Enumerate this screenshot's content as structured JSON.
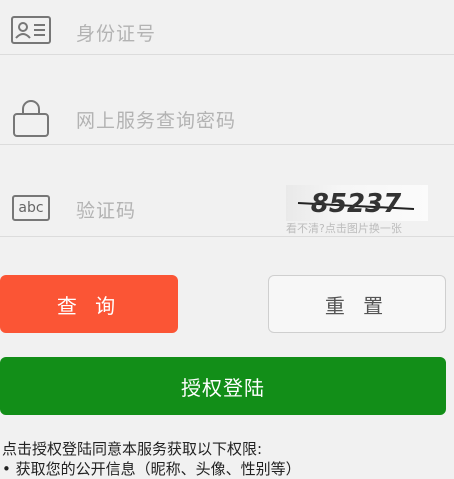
{
  "form": {
    "id_field": {
      "placeholder": "身份证号",
      "icon": "id-card-icon"
    },
    "password_field": {
      "placeholder": "网上服务查询密码",
      "icon": "lock-icon"
    },
    "captcha_field": {
      "placeholder": "验证码",
      "icon_text": "abc",
      "icon": "keyboard-icon"
    },
    "captcha": {
      "code": "85237",
      "hint": "看不清?点击图片换一张"
    }
  },
  "buttons": {
    "query_label": "查 询",
    "reset_label": "重 置",
    "authorize_label": "授权登陆"
  },
  "colors": {
    "query_bg": "#fb5535",
    "authorize_bg": "#128e18",
    "reset_bg": "#f7f7f7"
  },
  "notice": {
    "line1": "点击授权登陆同意本服务获取以下权限:",
    "line2": "• 获取您的公开信息（昵称、头像、性别等）"
  }
}
